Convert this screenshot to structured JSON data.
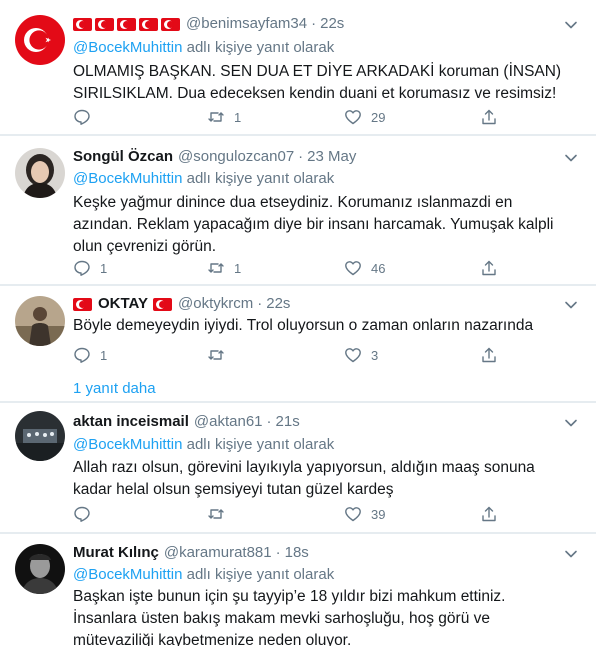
{
  "tweets": [
    {
      "name": "",
      "flags": 5,
      "handle": "@benimsayfam34",
      "time": "22s",
      "reply_prefix": "@BocekMuhittin",
      "reply_suffix": " adlı kişiye yanıt olarak",
      "text": "OLMAMIŞ BAŞKAN. SEN DUA ET DİYE ARKADAKİ koruman (İNSAN) SIRILSIKLAM. Dua edeceksen kendin duani et korumasız ve resimsiz!",
      "replies": "",
      "retweets": "1",
      "likes": "29"
    },
    {
      "name": "Songül Özcan",
      "handle": "@songulozcan07",
      "time": "23 May",
      "reply_prefix": "@BocekMuhittin",
      "reply_suffix": " adlı kişiye yanıt olarak",
      "text": "Keşke yağmur dinince dua etseydiniz. Korumanız ıslanmazdi en azından. Reklam yapacağım diye bir insanı harcamak. Yumuşak kalpli olun çevrenizi görün.",
      "replies": "1",
      "retweets": "1",
      "likes": "46"
    },
    {
      "name": "OKTAY",
      "handle": "@oktykrcm",
      "time": "22s",
      "text": "Böyle demeyeydin iyiydi. Trol oluyorsun o zaman onların nazarında",
      "replies": "1",
      "retweets": "",
      "likes": "3"
    },
    {
      "name": "aktan inceismail",
      "handle": "@aktan61",
      "time": "21s",
      "reply_prefix": "@BocekMuhittin",
      "reply_suffix": " adlı kişiye yanıt olarak",
      "text": "Allah razı olsun, görevini layıkıyla yapıyorsun, aldığın maaş sonuna kadar helal olsun şemsiyeyi tutan güzel kardeş",
      "replies": "",
      "retweets": "",
      "likes": "39"
    },
    {
      "name": "Murat Kılınç",
      "handle": "@karamurat881",
      "time": "18s",
      "reply_prefix": "@BocekMuhittin",
      "reply_suffix": " adlı kişiye yanıt olarak",
      "text": "Başkan işte bunun için şu tayyip’e 18 yıldır bizi mahkum ettiniz. İnsanlara üsten bakış makam mevki sarhoşluğu, hoş görü ve mütevaziliği kaybetmenize neden oluyor."
    }
  ],
  "show_more": "1 yanıt daha",
  "colors": {
    "link": "#1da1f2",
    "muted": "#657786",
    "flag": "#e30a17",
    "divider": "#e6ecf0"
  }
}
